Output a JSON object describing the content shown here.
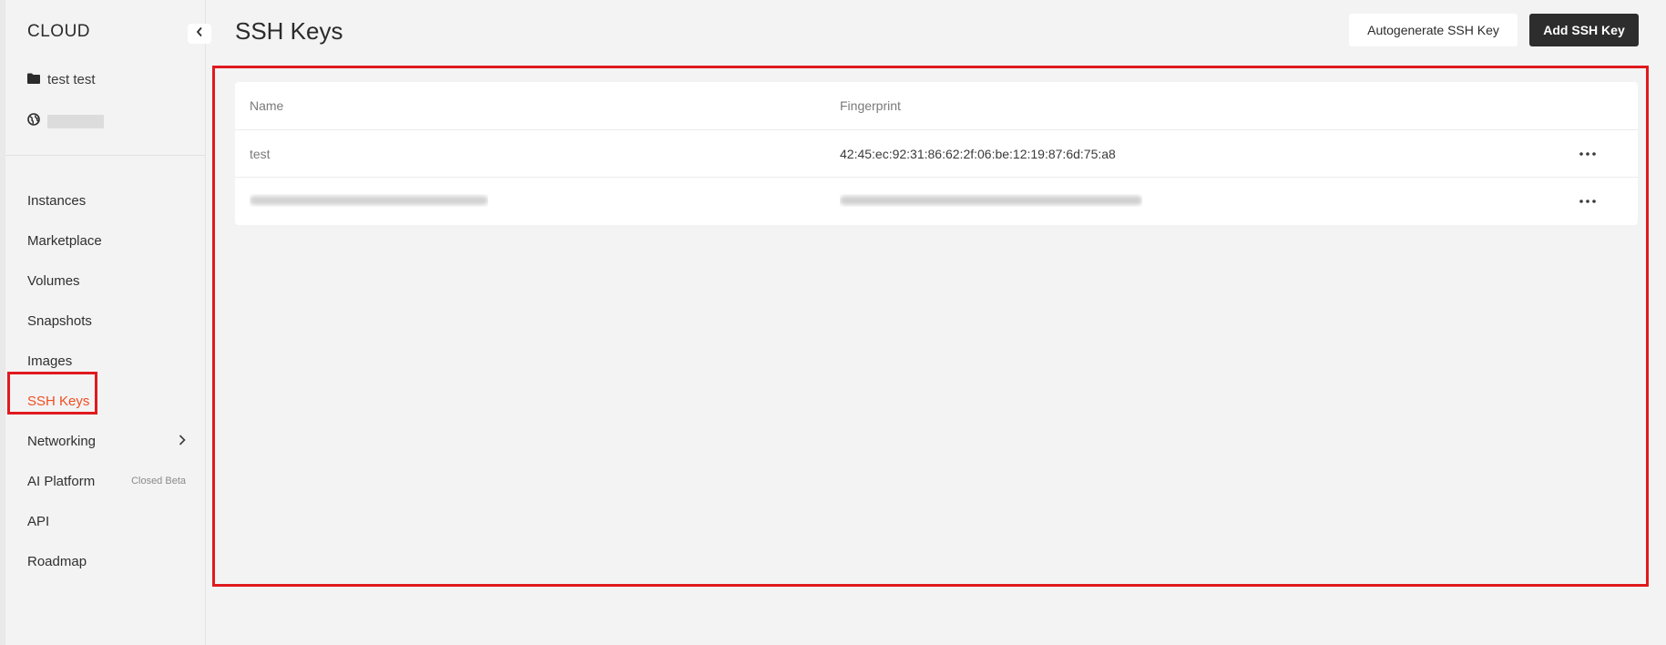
{
  "brand": "CLOUD",
  "project": {
    "name": "test test",
    "account_icon": "globe-icon",
    "folder_icon": "folder-icon"
  },
  "nav": {
    "items": [
      {
        "label": "Instances"
      },
      {
        "label": "Marketplace"
      },
      {
        "label": "Volumes"
      },
      {
        "label": "Snapshots"
      },
      {
        "label": "Images"
      },
      {
        "label": "SSH Keys",
        "active": true
      },
      {
        "label": "Networking",
        "has_submenu": true
      },
      {
        "label": "AI Platform",
        "badge": "Closed Beta"
      },
      {
        "label": "API"
      },
      {
        "label": "Roadmap"
      }
    ]
  },
  "page": {
    "title": "SSH Keys",
    "autogenerate_label": "Autogenerate SSH Key",
    "add_label": "Add SSH Key"
  },
  "table": {
    "columns": [
      "Name",
      "Fingerprint"
    ],
    "rows": [
      {
        "name": "test",
        "fingerprint": "42:45:ec:92:31:86:62:2f:06:be:12:19:87:6d:75:a8"
      },
      {
        "name": "",
        "fingerprint": "",
        "redacted": true
      }
    ]
  },
  "colors": {
    "accent": "#f04e23",
    "annotation_red": "#e0191e",
    "primary_button": "#2d2d2d"
  }
}
